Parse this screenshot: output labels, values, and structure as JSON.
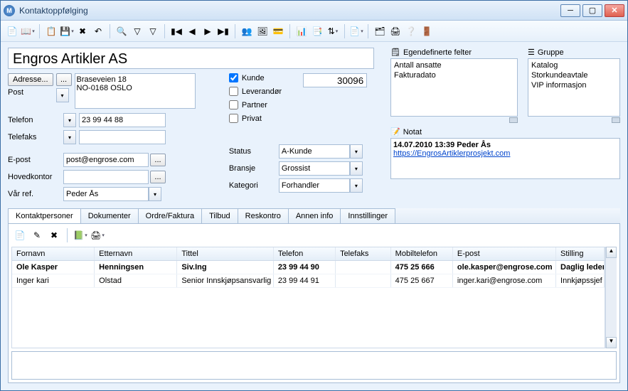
{
  "window": {
    "title": "Kontaktoppfølging"
  },
  "company": "Engros Artikler AS",
  "address": {
    "btn": "Adresse...",
    "ellipsis": "...",
    "text": "Braseveien 18\nNO-0168 OSLO"
  },
  "fields": {
    "post_lbl": "Post",
    "post_val": "",
    "telefon_lbl": "Telefon",
    "telefon_val": "23 99 44 88",
    "telefaks_lbl": "Telefaks",
    "telefaks_val": "",
    "epost_lbl": "E-post",
    "epost_val": "post@engrose.com",
    "hovedkontor_lbl": "Hovedkontor",
    "hovedkontor_val": "",
    "varref_lbl": "Vår ref.",
    "varref_val": "Peder Ås"
  },
  "checks": {
    "kunde": "Kunde",
    "kunde_checked": true,
    "leverandor": "Leverandør",
    "partner": "Partner",
    "privat": "Privat"
  },
  "kundenr": "30096",
  "dropdowns": {
    "status_lbl": "Status",
    "status_val": "A-Kunde",
    "bransje_lbl": "Bransje",
    "bransje_val": "Grossist",
    "kategori_lbl": "Kategori",
    "kategori_val": "Forhandler"
  },
  "egendefinerte": {
    "title": "Egendefinerte felter",
    "items": [
      "Antall ansatte",
      "Fakturadato"
    ]
  },
  "gruppe": {
    "title": "Gruppe",
    "items": [
      "Katalog",
      "Storkundeavtale",
      "VIP informasjon"
    ]
  },
  "notat": {
    "title": "Notat",
    "header": "14.07.2010 13:39 Peder Ås",
    "link": "https://EngrosArtiklerprosjekt.com"
  },
  "tabs": [
    "Kontaktpersoner",
    "Dokumenter",
    "Ordre/Faktura",
    "Tilbud",
    "Reskontro",
    "Annen info",
    "Innstillinger"
  ],
  "grid": {
    "cols": [
      "Fornavn",
      "Etternavn",
      "Tittel",
      "Telefon",
      "Telefaks",
      "Mobiltelefon",
      "E-post",
      "Stilling"
    ],
    "rows": [
      {
        "bold": true,
        "c": [
          "Ole Kasper",
          "Henningsen",
          "Siv.Ing",
          "23 99 44 90",
          "",
          "475 25 666",
          "ole.kasper@engrose.com",
          "Daglig leder"
        ]
      },
      {
        "bold": false,
        "c": [
          "Inger kari",
          "Olstad",
          "Senior Innskjøpsansvarlig",
          "23 99 44 91",
          "",
          "475 25 667",
          "inger.kari@engrose.com",
          "Innkjøpssjef"
        ]
      }
    ]
  }
}
